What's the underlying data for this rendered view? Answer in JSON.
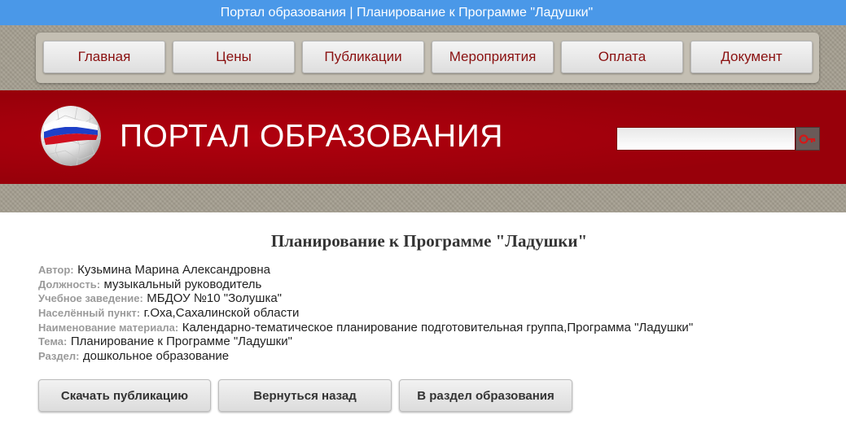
{
  "window": {
    "title": "Портал образования | Планирование к Программе \"Ладушки\""
  },
  "nav": {
    "items": [
      {
        "label": "Главная"
      },
      {
        "label": "Цены"
      },
      {
        "label": "Публикации"
      },
      {
        "label": "Мероприятия"
      },
      {
        "label": "Оплата"
      },
      {
        "label": "Документ"
      }
    ]
  },
  "banner": {
    "title": "ПОРТАЛ ОБРАЗОВАНИЯ",
    "search_placeholder": "",
    "logo_icon": "russia-flag-globe-icon",
    "search_icon": "key-icon"
  },
  "publication": {
    "title": "Планирование к Программе \"Ладушки\"",
    "fields": [
      {
        "label": "Автор:",
        "value": "Кузьмина Марина Александровна"
      },
      {
        "label": "Должность:",
        "value": "музыкальный руководитель"
      },
      {
        "label": "Учебное заведение:",
        "value": "МБДОУ №10 \"Золушка\""
      },
      {
        "label": "Населённый пункт:",
        "value": "г.Оха,Сахалинской области"
      },
      {
        "label": "Наименование материала:",
        "value": "Календарно-тематическое планирование подготовительная группа,Программа \"Ладушки\""
      },
      {
        "label": "Тема:",
        "value": "Планирование к Программе \"Ладушки\""
      },
      {
        "label": "Раздел:",
        "value": "дошкольное образование"
      }
    ]
  },
  "actions": {
    "download": "Скачать публикацию",
    "back": "Вернуться назад",
    "section": "В раздел образования"
  },
  "colors": {
    "titlebar": "#4a98e8",
    "banner_red": "#a00009",
    "nav_text": "#8a1010",
    "label_gray": "#9a9a9a"
  }
}
